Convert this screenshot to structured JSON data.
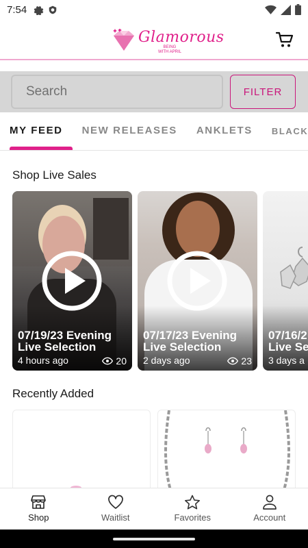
{
  "status_bar": {
    "time": "7:54",
    "left_icons": [
      "settings-icon",
      "shield-icon"
    ],
    "right_icons": [
      "wifi-icon",
      "signal-icon",
      "battery-icon"
    ]
  },
  "header": {
    "logo_text": "Glamorous",
    "logo_subtext": "BEING WITH APRIL",
    "cart_icon": "cart-icon",
    "brand_color": "#e0208a"
  },
  "search": {
    "placeholder": "Search",
    "filter_label": "FILTER"
  },
  "tabs": [
    {
      "label": "MY FEED",
      "active": true
    },
    {
      "label": "NEW RELEASES",
      "active": false
    },
    {
      "label": "ANKLETS",
      "active": false
    },
    {
      "label": "BLACK/PI",
      "active": false
    }
  ],
  "live_sales": {
    "title": "Shop Live Sales",
    "cards": [
      {
        "title": "07/19/23 Evening Live Selection",
        "time_ago": "4 hours ago",
        "views": "20"
      },
      {
        "title": "07/17/23 Evening Live Selection",
        "time_ago": "2 days ago",
        "views": "23"
      },
      {
        "title": "07/16/2",
        "title_line2": "Live Se",
        "time_ago": "3 days a"
      }
    ]
  },
  "recently_added": {
    "title": "Recently Added"
  },
  "bottom_nav": [
    {
      "label": "Shop",
      "icon": "store-icon",
      "active": true
    },
    {
      "label": "Waitlist",
      "icon": "heart-icon",
      "active": false
    },
    {
      "label": "Favorites",
      "icon": "star-icon",
      "active": false
    },
    {
      "label": "Account",
      "icon": "person-icon",
      "active": false
    }
  ]
}
